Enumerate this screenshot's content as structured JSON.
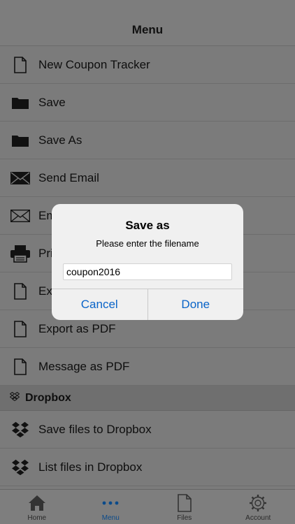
{
  "nav": {
    "title": "Menu"
  },
  "menu": {
    "items": [
      {
        "label": "New Coupon Tracker",
        "icon": "document-icon"
      },
      {
        "label": "Save",
        "icon": "folder-icon"
      },
      {
        "label": "Save As",
        "icon": "folder-icon"
      },
      {
        "label": "Send Email",
        "icon": "envelope-filled-icon"
      },
      {
        "label": "Em",
        "icon": "envelope-outline-icon"
      },
      {
        "label": "Pri",
        "icon": "printer-icon"
      },
      {
        "label": "Ex",
        "icon": "document-icon"
      },
      {
        "label": "Export as PDF",
        "icon": "document-icon"
      },
      {
        "label": "Message as PDF",
        "icon": "document-icon"
      }
    ],
    "dropbox_section": {
      "label": "Dropbox",
      "icon": "dropbox-icon"
    },
    "dropbox_items": [
      {
        "label": "Save files to Dropbox",
        "icon": "dropbox-icon"
      },
      {
        "label": "List files in Dropbox",
        "icon": "dropbox-icon"
      }
    ]
  },
  "dialog": {
    "title": "Save as",
    "message": "Please enter the filename",
    "input_value": "coupon2016",
    "cancel_label": "Cancel",
    "done_label": "Done"
  },
  "tabs": [
    {
      "label": "Home",
      "icon": "home-icon",
      "active": false
    },
    {
      "label": "Menu",
      "icon": "more-icon",
      "active": true
    },
    {
      "label": "Files",
      "icon": "file-icon",
      "active": false
    },
    {
      "label": "Account",
      "icon": "gear-icon",
      "active": false
    }
  ],
  "colors": {
    "accent": "#0a64c8",
    "dim_overlay": "#7b7b7b"
  }
}
